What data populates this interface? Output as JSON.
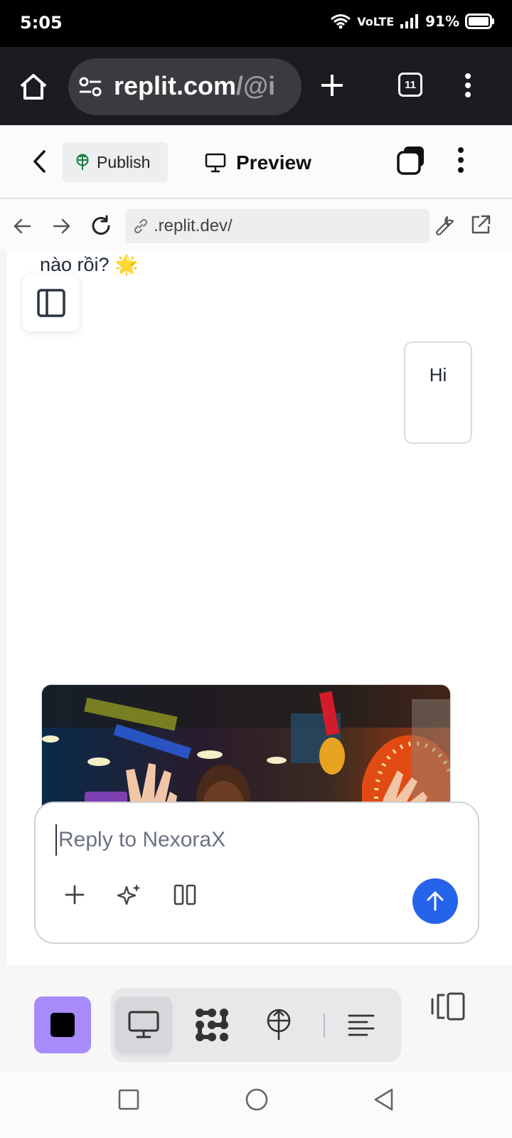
{
  "status_bar": {
    "time": "5:05",
    "network": "VoLTE",
    "battery": "91%"
  },
  "browser": {
    "url_domain": "replit.com",
    "url_path": "/@i",
    "tab_count": "11"
  },
  "header": {
    "publish_label": "Publish",
    "preview_label": "Preview"
  },
  "preview_toolbar": {
    "url": ".replit.dev/"
  },
  "chat": {
    "previous_message": "nào rồi? 🌟",
    "user_message": "Hi"
  },
  "composer": {
    "placeholder": "Reply to NexoraX"
  },
  "colors": {
    "accent": "#2563eb",
    "stop_button": "#a78bfa",
    "browser_bar": "#1b1c1f"
  },
  "icons": {
    "status": [
      "wifi-icon",
      "signal-icon",
      "battery-icon"
    ],
    "browser": [
      "home-icon",
      "site-settings-icon",
      "new-tab-icon",
      "tabs-icon",
      "more-vert-icon"
    ],
    "header": [
      "back-icon",
      "publish-icon",
      "monitor-icon",
      "window-stack-icon",
      "more-vert-icon"
    ],
    "preview_toolbar": [
      "arrow-left-icon",
      "arrow-right-icon",
      "refresh-icon",
      "link-icon",
      "wrench-icon",
      "external-link-icon"
    ],
    "composer": [
      "plus-icon",
      "sparkles-icon",
      "columns-icon",
      "arrow-up-icon"
    ],
    "bottom_bar": [
      "stop-icon",
      "monitor-icon",
      "nodes-icon",
      "publish-icon",
      "text-align-icon",
      "split-view-icon"
    ],
    "android_nav": [
      "recents-icon",
      "home-circle-icon",
      "back-triangle-icon"
    ]
  }
}
